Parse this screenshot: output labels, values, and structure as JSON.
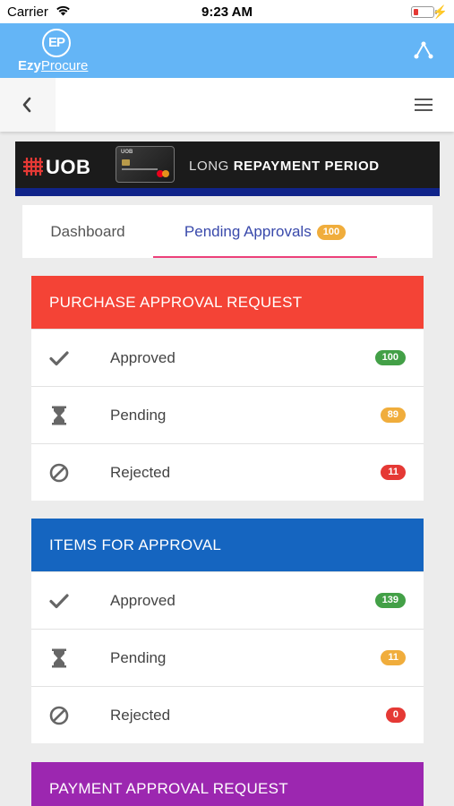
{
  "status_bar": {
    "carrier": "Carrier",
    "time": "9:23 AM"
  },
  "app": {
    "logo_mark": "EP",
    "brand_bold": "Ezy",
    "brand_rest": "Procure"
  },
  "banner": {
    "bank": "UOB",
    "card_name": "UOB",
    "tagline_light": "LONG ",
    "tagline_bold": "REPAYMENT PERIOD"
  },
  "tabs": [
    {
      "label": "Dashboard"
    },
    {
      "label": "Pending Approvals",
      "badge": "100"
    }
  ],
  "sections": [
    {
      "title": "PURCHASE APPROVAL REQUEST",
      "color": "#f44336",
      "rows": [
        {
          "label": "Approved",
          "count": "100",
          "icon": "check-icon"
        },
        {
          "label": "Pending",
          "count": "89",
          "icon": "hourglass-icon"
        },
        {
          "label": "Rejected",
          "count": "11",
          "icon": "block-icon"
        }
      ]
    },
    {
      "title": "ITEMS FOR APPROVAL",
      "color": "#1565c0",
      "rows": [
        {
          "label": "Approved",
          "count": "139",
          "icon": "check-icon"
        },
        {
          "label": "Pending",
          "count": "11",
          "icon": "hourglass-icon"
        },
        {
          "label": "Rejected",
          "count": "0",
          "icon": "block-icon"
        }
      ]
    },
    {
      "title": "PAYMENT APPROVAL REQUEST",
      "color": "#9c27b0"
    }
  ],
  "colors": {
    "appbar": "#64b5f6",
    "approved": "#43a047",
    "pending": "#f0ad3c",
    "rejected": "#e53935",
    "tab_active": "#3949ab",
    "tab_indicator": "#ec407a"
  }
}
